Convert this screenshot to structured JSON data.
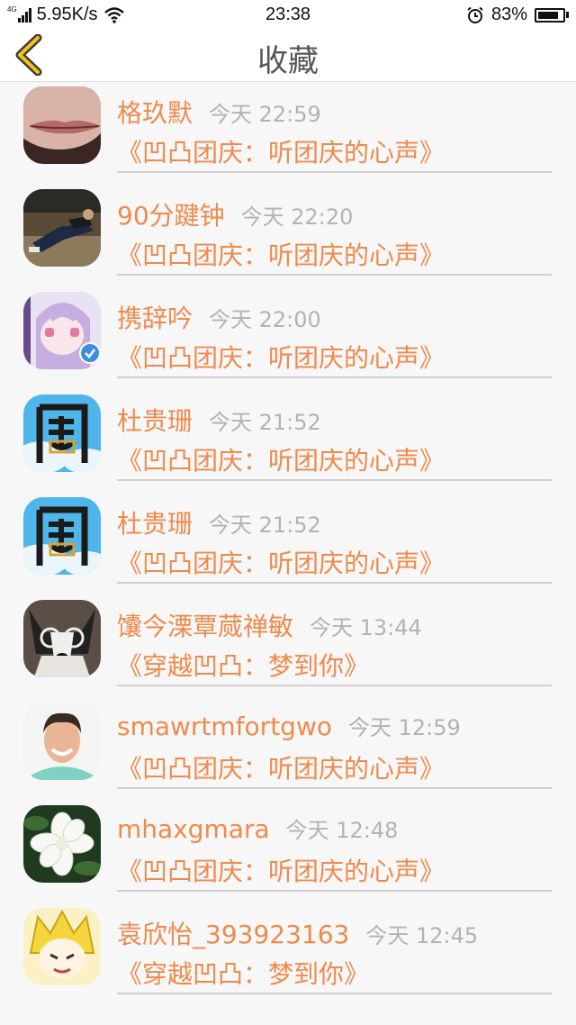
{
  "status": {
    "network": "4G",
    "speed": "5.95K/s",
    "time": "23:38",
    "battery": "83%",
    "battery_level": 0.83
  },
  "header": {
    "title": "收藏"
  },
  "items": [
    {
      "name": "格玖默",
      "time": "今天 22:59",
      "title": "《凹凸团庆：听团庆的心声》",
      "avatar": "lips-photo"
    },
    {
      "name": "90分踺钟",
      "time": "今天 22:20",
      "title": "《凹凸团庆：听团庆的心声》",
      "avatar": "person-lying-photo"
    },
    {
      "name": "携辞吟",
      "time": "今天 22:00",
      "title": "《凹凸团庆：听团庆的心声》",
      "avatar": "anime-girl",
      "verified": true
    },
    {
      "name": "杜贵珊",
      "time": "今天 21:52",
      "title": "《凹凸团庆：听团庆的心声》",
      "avatar": "glyph-sky"
    },
    {
      "name": "杜贵珊",
      "time": "今天 21:52",
      "title": "《凹凸团庆：听团庆的心声》",
      "avatar": "glyph-sky"
    },
    {
      "name": "馕今溧覃蒇禅敏",
      "time": "今天 13:44",
      "title": "《穿越凹凸：梦到你》",
      "avatar": "dog-glasses"
    },
    {
      "name": "smawrtmfortgwo",
      "time": "今天 12:59",
      "title": "《凹凸团庆：听团庆的心声》",
      "avatar": "smiling-man"
    },
    {
      "name": "mhaxgmara",
      "time": "今天 12:48",
      "title": "《凹凸团庆：听团庆的心声》",
      "avatar": "white-flower"
    },
    {
      "name": "袁欣怡_393923163",
      "time": "今天 12:45",
      "title": "《穿越凹凸：梦到你》",
      "avatar": "anime-blonde"
    }
  ]
}
